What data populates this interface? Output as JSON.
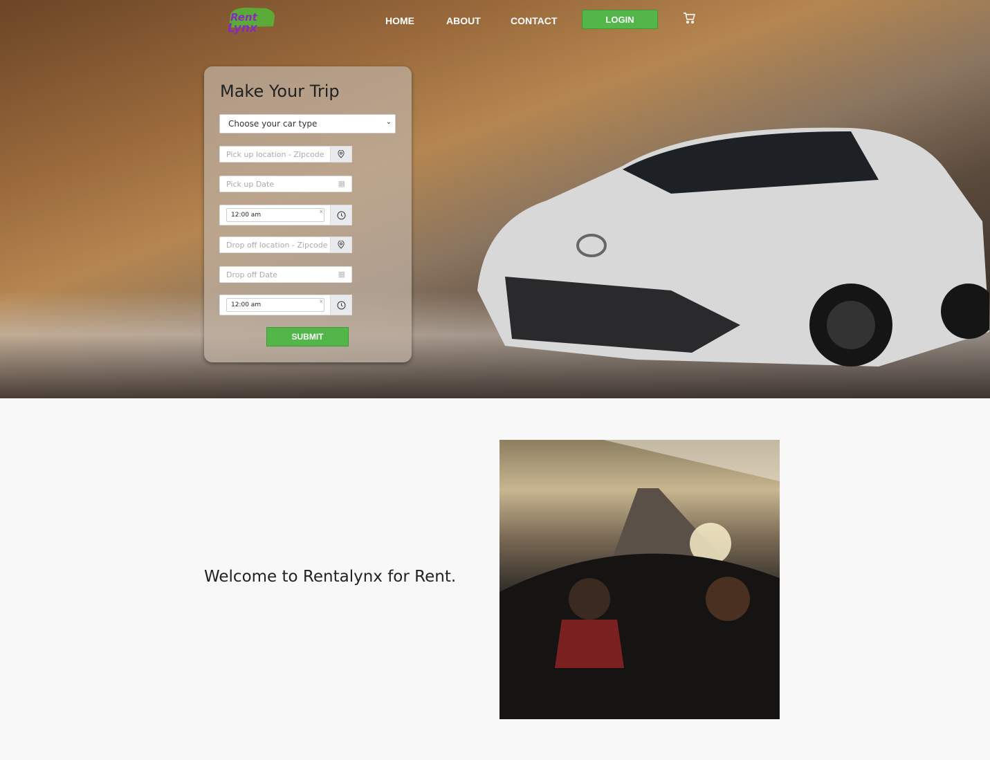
{
  "header": {
    "logo_text": "Rent A Lynx",
    "nav": [
      "HOME",
      "ABOUT",
      "CONTACT"
    ],
    "login_label": "LOGIN",
    "cart_icon": "cart-icon"
  },
  "form": {
    "title": "Make Your Trip",
    "car_type": "Choose your car type",
    "pickup_location_placeholder": "Pick up location - Zipcode",
    "pickup_date_placeholder": "Pick up Date",
    "pickup_time": "12:00 am",
    "dropoff_location_placeholder": "Drop off location - Zipcode",
    "dropoff_date_placeholder": "Drop off Date",
    "dropoff_time": "12:00 am",
    "submit_label": "SUBMIT"
  },
  "welcome": {
    "text": "Welcome to Rentalynx for Rent."
  },
  "colors": {
    "accent": "#52b748"
  }
}
